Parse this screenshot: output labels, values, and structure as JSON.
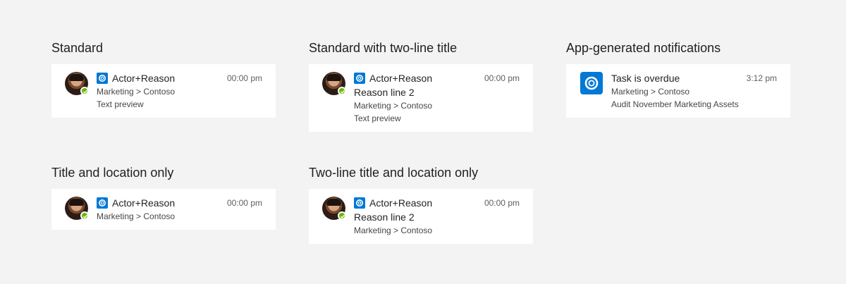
{
  "sections": [
    {
      "title": "Standard",
      "card": {
        "title": "Actor+Reason",
        "time": "00:00 pm",
        "location": "Marketing > Contoso",
        "preview": "Text preview"
      }
    },
    {
      "title": "Standard with two-line title",
      "card": {
        "title": "Actor+Reason",
        "time": "00:00 pm",
        "reason2": "Reason line 2",
        "location": "Marketing > Contoso",
        "preview": "Text preview"
      }
    },
    {
      "title": "App-generated notifications",
      "card": {
        "title": "Task is overdue",
        "time": "3:12 pm",
        "location": "Marketing > Contoso",
        "preview": "Audit November Marketing Assets"
      }
    },
    {
      "title": "Title and location only",
      "card": {
        "title": "Actor+Reason",
        "time": "00:00 pm",
        "location": "Marketing > Contoso"
      }
    },
    {
      "title": "Two-line title and location only",
      "card": {
        "title": "Actor+Reason",
        "time": "00:00 pm",
        "reason2": "Reason line 2",
        "location": "Marketing > Contoso"
      }
    }
  ],
  "icons": {
    "avatar": "user-avatar",
    "presence": "presence-available-icon",
    "app": "app-ring-icon"
  },
  "colors": {
    "background": "#f3f3f3",
    "card": "#ffffff",
    "accent": "#0078d4",
    "presence": "#6bb700"
  }
}
